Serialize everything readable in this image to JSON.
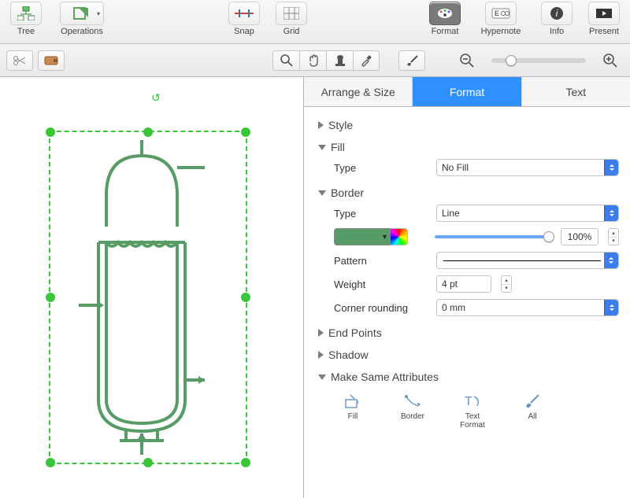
{
  "topbar": {
    "tree": "Tree",
    "operations": "Operations",
    "snap": "Snap",
    "grid": "Grid",
    "format": "Format",
    "hypernote": "Hypernote",
    "info": "Info",
    "present": "Present"
  },
  "inspector": {
    "tabs": {
      "arrange": "Arrange & Size",
      "format": "Format",
      "text": "Text",
      "active": "format"
    },
    "style": {
      "label": "Style"
    },
    "fill": {
      "label": "Fill",
      "type_label": "Type",
      "type_value": "No Fill"
    },
    "border": {
      "label": "Border",
      "type_label": "Type",
      "type_value": "Line",
      "color": "#579b66",
      "opacity": "100%",
      "pattern_label": "Pattern",
      "weight_label": "Weight",
      "weight_value": "4 pt",
      "corner_label": "Corner rounding",
      "corner_value": "0 mm"
    },
    "endpoints": {
      "label": "End Points"
    },
    "shadow": {
      "label": "Shadow"
    },
    "makesame": {
      "label": "Make Same Attributes",
      "fill": "Fill",
      "border": "Border",
      "textfmt": "Text Format",
      "all": "All"
    }
  },
  "canvas": {
    "selection_color": "#39c639",
    "shape_stroke": "#579b66"
  }
}
